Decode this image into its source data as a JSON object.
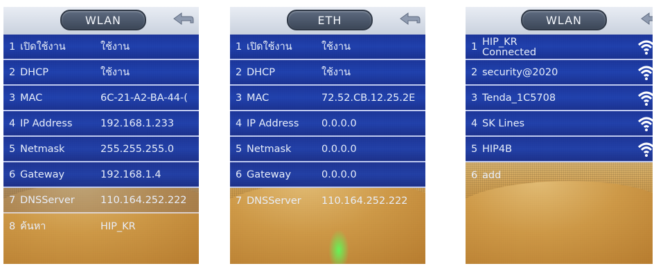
{
  "screens": [
    {
      "title": "WLAN",
      "rows": [
        {
          "num": "1",
          "label": "เปิดใช้งาน",
          "value": "ใช้งาน"
        },
        {
          "num": "2",
          "label": "DHCP",
          "value": "ใช้งาน"
        },
        {
          "num": "3",
          "label": "MAC",
          "value": "6C-21-A2-BA-44-("
        },
        {
          "num": "4",
          "label": "IP Address",
          "value": "192.168.1.233"
        },
        {
          "num": "5",
          "label": "Netmask",
          "value": "255.255.255.0"
        },
        {
          "num": "6",
          "label": "Gateway",
          "value": "192.168.1.4"
        },
        {
          "num": "7",
          "label": "DNSServer",
          "value": "110.164.252.222"
        },
        {
          "num": "8",
          "label": "ค้นหา",
          "value": "HIP_KR"
        }
      ]
    },
    {
      "title": "ETH",
      "rows": [
        {
          "num": "1",
          "label": "เปิดใช้งาน",
          "value": "ใช้งาน"
        },
        {
          "num": "2",
          "label": "DHCP",
          "value": "ใช้งาน"
        },
        {
          "num": "3",
          "label": "MAC",
          "value": "72.52.CB.12.25.2E"
        },
        {
          "num": "4",
          "label": "IP Address",
          "value": "0.0.0.0"
        },
        {
          "num": "5",
          "label": "Netmask",
          "value": "0.0.0.0"
        },
        {
          "num": "6",
          "label": "Gateway",
          "value": "0.0.0.0"
        },
        {
          "num": "7",
          "label": "DNSServer",
          "value": "110.164.252.222"
        }
      ]
    },
    {
      "title": "WLAN",
      "networks": [
        {
          "num": "1",
          "name": "HIP_KR",
          "status": "Connected"
        },
        {
          "num": "2",
          "name": "security@2020",
          "status": ""
        },
        {
          "num": "3",
          "name": "Tenda_1C5708",
          "status": ""
        },
        {
          "num": "4",
          "name": "SK Lines",
          "status": ""
        },
        {
          "num": "5",
          "name": "HIP4B",
          "status": ""
        }
      ],
      "add_row": {
        "num": "6",
        "label": "add"
      }
    }
  ],
  "icons": {
    "back": "back-arrow-icon",
    "wifi": "wifi-signal-icon"
  },
  "colors": {
    "row_bg": "#1a35a0",
    "row_text": "#e8eef9",
    "header_bg": "#dfe4ec",
    "wifi_icon": "#ffffff"
  }
}
